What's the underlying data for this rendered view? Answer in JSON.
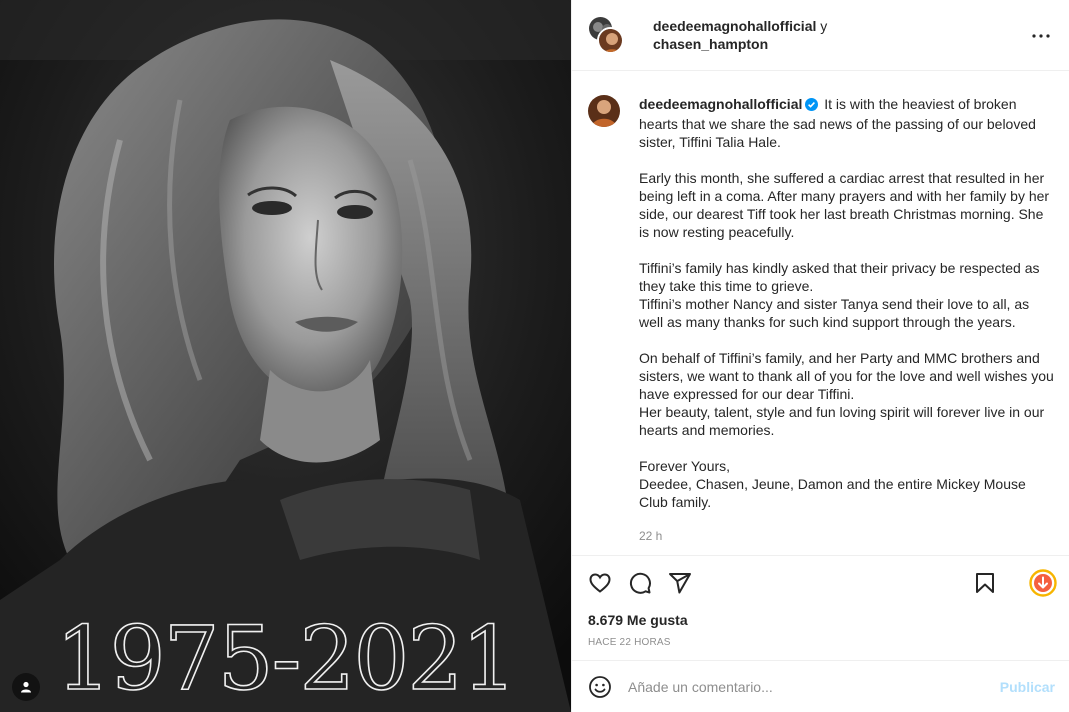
{
  "media": {
    "years_text": "1975-2021"
  },
  "header": {
    "username_1": "deedeemagnohallofficial",
    "joiner": "y",
    "username_2": "chasen_hampton"
  },
  "caption": {
    "username": "deedeemagnohallofficial",
    "paragraphs": [
      "It is with the heaviest of broken hearts that we share the sad news of the passing of our beloved sister, Tiffini Talia Hale.",
      "Early this month, she suffered a cardiac arrest that resulted in her being left in a coma. After many prayers and with her family by her side, our dearest Tiff took her last breath Christmas morning. She is now resting peacefully.",
      "Tiffini’s family has kindly asked that their privacy be respected as they take this time to grieve.",
      "Tiffini’s mother Nancy and sister Tanya send their love to all, as well as many thanks for such kind support through the years.",
      "On behalf of Tiffini’s family, and her Party and MMC brothers and sisters, we want to thank all of you for the love and well wishes you have expressed for our dear Tiffini.",
      "Her beauty, talent, style and fun loving spirit will forever live in our hearts and memories.",
      "Forever Yours,",
      "Deedee, Chasen, Jeune, Damon and the entire Mickey Mouse Club family."
    ],
    "time": "22 h"
  },
  "actions": {
    "icons": [
      "heart-icon",
      "comment-icon",
      "share-icon",
      "bookmark-icon",
      "download-icon"
    ],
    "accent": "#f56040"
  },
  "likes": "8.679 Me gusta",
  "ago": "HACE 22 HORAS",
  "comment": {
    "placeholder": "Añade un comentario...",
    "post_label": "Publicar"
  },
  "colors": {
    "verified": "#0095f6",
    "post_disabled": "#b2dffc",
    "muted": "#8e8e8e",
    "border": "#efefef"
  }
}
